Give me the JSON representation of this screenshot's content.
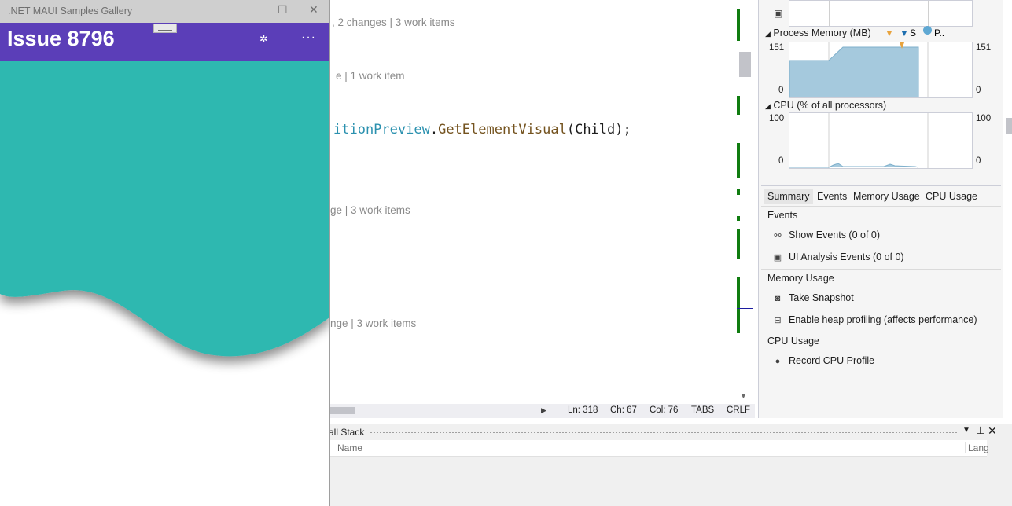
{
  "maui": {
    "window_title": ".NET MAUI Samples Gallery",
    "page_title": "Issue 8796",
    "minimize": "—",
    "maximize": "☐",
    "close": "✕",
    "settings_icon": "✲",
    "more_icon": "···",
    "shape_color": "#2eb8b0",
    "nav_color": "#5b3eb8"
  },
  "editor": {
    "lens1": ", 2 changes | 3 work items",
    "lens2": "e | 1 work item",
    "lens3": "ge | 3 work items",
    "lens4": "nge | 3 work items",
    "code_type": "itionPreview",
    "code_dot": ".",
    "code_method": "GetElementVisual",
    "code_rest": "(Child);"
  },
  "statusbar": {
    "ln": "Ln: 318",
    "ch": "Ch: 67",
    "col": "Col: 76",
    "tabs": "TABS",
    "eol": "CRLF"
  },
  "diagnostics": {
    "process_memory": {
      "title": "Process Memory (MB)",
      "legend_s": "S",
      "legend_p": "P..",
      "y_max_left": "151",
      "y_min_left": "0",
      "y_max_right": "151",
      "y_min_right": "0"
    },
    "cpu": {
      "title": "CPU (% of all processors)",
      "y_max_left": "100",
      "y_min_left": "0",
      "y_max_right": "100",
      "y_min_right": "0"
    },
    "tabs": [
      "Summary",
      "Events",
      "Memory Usage",
      "CPU Usage"
    ],
    "events_header": "Events",
    "show_events": "Show Events (0 of 0)",
    "ui_analysis": "UI Analysis Events (0 of 0)",
    "memory_header": "Memory Usage",
    "take_snapshot": "Take Snapshot",
    "heap_profiling": "Enable heap profiling (affects performance)",
    "cpu_header": "CPU Usage",
    "record_cpu": "Record CPU Profile"
  },
  "callstack": {
    "title": "all Stack",
    "col_name": "Name",
    "col_lang": "Lang"
  }
}
